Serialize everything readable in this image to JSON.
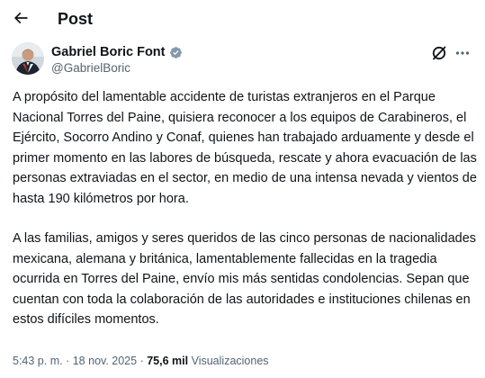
{
  "header": {
    "title": "Post",
    "back_icon": "arrow-left-icon"
  },
  "author": {
    "display_name": "Gabriel Boric Font",
    "handle": "@GabrielBoric",
    "verified": true,
    "verified_color": "#829aab"
  },
  "actions": {
    "grok_icon": "grok-icon",
    "more_icon": "more-horizontal-icon"
  },
  "tweet": {
    "paragraphs": [
      "A propósito del lamentable accidente de turistas extranjeros en el Parque Nacional Torres del Paine, quisiera reconocer a los equipos de Carabineros, el Ejército, Socorro Andino y Conaf, quienes han trabajado arduamente y desde el primer momento en las labores de búsqueda, rescate y ahora evacuación de las personas extraviadas en el sector, en medio de una intensa nevada y vientos de hasta 190 kilómetros por hora.",
      "A las familias, amigos y seres queridos de las cinco personas de nacionalidades mexicana, alemana y británica, lamentablemente fallecidas en la tragedia ocurrida en Torres del Paine, envío mis más sentidas condolencias. Sepan que cuentan con toda la colaboración de las autoridades e instituciones chilenas en estos difíciles momentos."
    ]
  },
  "meta": {
    "time": "5:43 p. m.",
    "separator": "·",
    "date": "18 nov. 2025",
    "views_count": "75,6 mil",
    "views_label": "Visualizaciones"
  },
  "colors": {
    "text": "#0f1419",
    "secondary": "#536471"
  }
}
